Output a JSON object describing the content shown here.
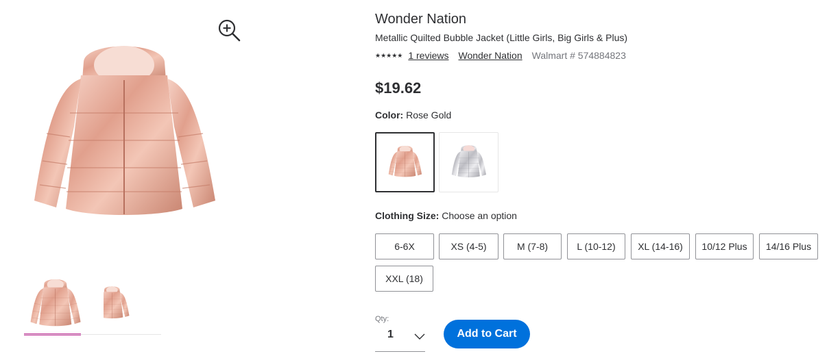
{
  "product": {
    "brand": "Wonder Nation",
    "title": "Metallic Quilted Bubble Jacket (Little Girls, Big Girls & Plus)",
    "stars": "★★★★★",
    "reviews_link": "1 reviews",
    "brand_link": "Wonder Nation",
    "sku": "Walmart # 574884823",
    "price": "$19.62"
  },
  "gallery": {
    "zoom_icon": "zoom-in-icon",
    "main_image_alt": "rose-gold-jacket",
    "thumbnails": [
      "front-view",
      "side-view"
    ],
    "selected_index": 0
  },
  "color": {
    "label": "Color:",
    "value": "Rose Gold",
    "swatches": [
      "Rose Gold",
      "Silver"
    ],
    "selected_index": 0
  },
  "size": {
    "label": "Clothing Size:",
    "value": "Choose an option",
    "options": [
      "6-6X",
      "XS (4-5)",
      "M (7-8)",
      "L (10-12)",
      "XL (14-16)",
      "10/12 Plus",
      "14/16 Plus",
      "XXL (18)"
    ]
  },
  "quantity": {
    "label": "Qty:",
    "value": "1",
    "chevron_icon": "chevron-down-icon"
  },
  "actions": {
    "add_to_cart": "Add to Cart"
  },
  "colors": {
    "accent": "#0071dc",
    "thumb_selected": "#c13399",
    "text": "#2e2f32",
    "muted": "#74767c",
    "rose_gold": "#e9b3a2",
    "silver": "#d9d9dd"
  }
}
